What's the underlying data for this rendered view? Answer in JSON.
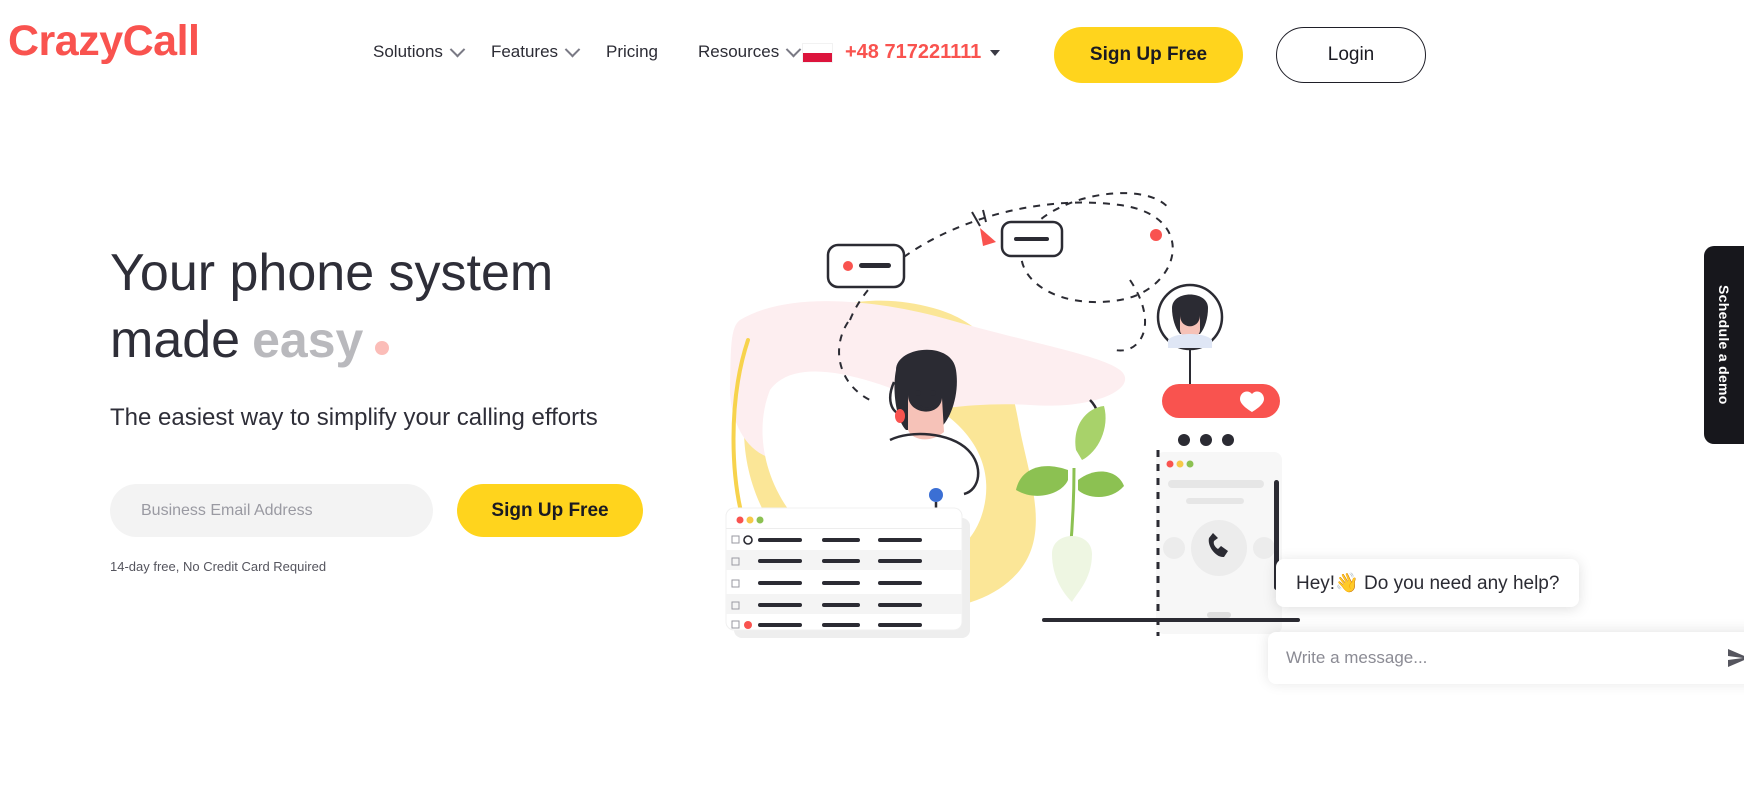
{
  "header": {
    "logo": "CrazyCall",
    "nav": [
      {
        "label": "Solutions",
        "has_caret": true
      },
      {
        "label": "Features",
        "has_caret": true
      },
      {
        "label": "Pricing",
        "has_caret": false
      },
      {
        "label": "Resources",
        "has_caret": true
      }
    ],
    "phone": {
      "number": "+48 717221111",
      "flag": "poland-flag-icon"
    },
    "signup_label": "Sign Up Free",
    "login_label": "Login"
  },
  "hero": {
    "headline_static": "Your phone system made",
    "headline_rotating": "easy",
    "subhead": "The easiest way to simplify your calling efforts",
    "email_placeholder": "Business Email Address",
    "email_value": "",
    "signup_label": "Sign Up Free",
    "fineprint": "14-day free, No Credit Card Required"
  },
  "demo_tab": {
    "label": "Schedule a demo"
  },
  "chat": {
    "greeting": "Hey!👋 Do you need any help?",
    "input_placeholder": "Write a message...",
    "input_value": "",
    "send_icon": "send-icon"
  },
  "colors": {
    "brand_red": "#f9534f",
    "accent_yellow": "#ffd41d",
    "dark": "#17171c",
    "muted_gray": "#b9b9bd",
    "pink_dot": "#fbbdb8"
  }
}
